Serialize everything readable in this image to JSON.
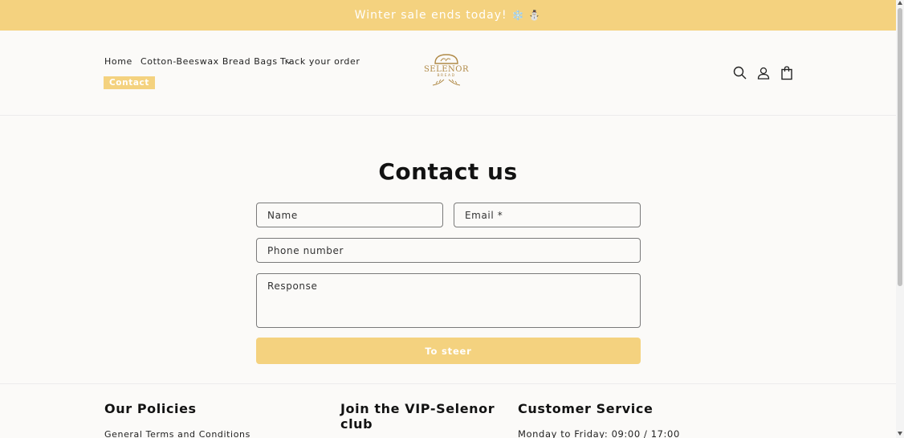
{
  "announcement": {
    "text": "Winter sale ends today!",
    "emojis": "❄️ ⛄"
  },
  "nav": {
    "home": "Home",
    "bread_bags": "Cotton-Beeswax Bread Bags",
    "track": "Track your order",
    "contact": "Contact"
  },
  "logo": {
    "brand": "SELENOR",
    "sub": "BREAD"
  },
  "header_icons": [
    "search-icon",
    "account-icon",
    "cart-icon"
  ],
  "page": {
    "title": "Contact us"
  },
  "form": {
    "name_placeholder": "Name",
    "email_placeholder": "Email *",
    "phone_placeholder": "Phone number",
    "response_placeholder": "Response",
    "submit_label": "To steer"
  },
  "footer": {
    "policies_heading": "Our Policies",
    "policies_link_1": "General Terms and Conditions",
    "vip_heading": "Join the VIP-Selenor club",
    "service_heading": "Customer Service",
    "service_hours": "Monday to Friday: 09:00 / 17:00"
  },
  "colors": {
    "accent": "#f4d27f",
    "logo": "#b08a47",
    "background": "#fbfaf8"
  }
}
